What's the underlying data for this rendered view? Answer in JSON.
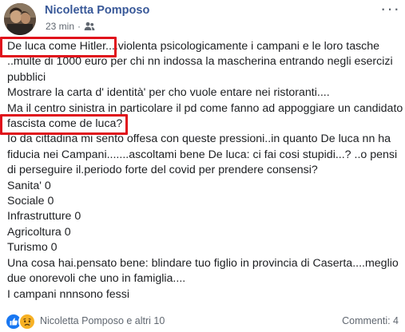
{
  "post": {
    "author": "Nicoletta Pomposo",
    "time": "23 min",
    "dot": "·",
    "more": "···",
    "lines": [
      "De luca come Hitler....violenta psicologicamente i campani e le loro tasche",
      "..multe di 1000 euro per chi nn indossa la mascherina entrando negli esercizi",
      "pubblici",
      "Mostrare la carta d' identità' per cho vuole entare nei ristoranti....",
      "Ma il centro sinistra in particolare il pd come fanno ad appoggiare un candidato",
      "fascista come de luca?",
      "Io da cittadina mi sento offesa con queste pressioni..in quanto De luca nn ha",
      "fiducia nei Campani.......ascoltami bene De luca: ci fai cosi stupidi...? ..o pensi",
      "di perseguire il.periodo forte del covid per prendere consensi?",
      "Sanita' 0",
      "Sociale 0",
      "Infrastrutture 0",
      "Agricoltura 0",
      "Turismo 0",
      "Una cosa hai.pensato bene: blindare tuo figlio in provincia di Caserta....meglio",
      "due onorevoli che uno in famiglia....",
      "I campani nnnsono fessi"
    ]
  },
  "footer": {
    "reactions_text": "Nicoletta Pomposo e altri 10",
    "comments": "Commenti: 4"
  },
  "colors": {
    "author": "#385898",
    "highlight": "#e0111b",
    "like": "#1877f2",
    "sad": "#f7b125"
  },
  "icons": {
    "audience": "friends-icon",
    "more": "more-options-icon",
    "reaction_like": "like-reaction-icon",
    "reaction_sad": "sad-reaction-icon"
  }
}
